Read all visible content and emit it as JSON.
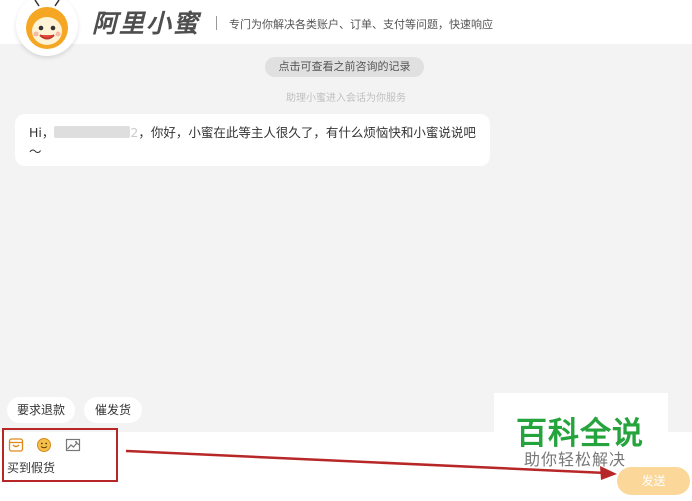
{
  "header": {
    "brand": "阿里小蜜",
    "tagline": "专门为你解决各类账户、订单、支付等问题，快速响应"
  },
  "chat": {
    "history_link": "点击可查看之前咨询的记录",
    "system_note": "助理小蜜进入会话为你服务",
    "greeting": {
      "prefix": "Hi，",
      "masked_suffix": "2",
      "body": "，你好，小蜜在此等主人很久了，有什么烦恼快和小蜜说说吧～"
    }
  },
  "quick_replies": [
    "要求退款",
    "催发货"
  ],
  "toolbar": {
    "icons": [
      "order-icon",
      "emoji-icon",
      "image-icon"
    ]
  },
  "input": {
    "value": "买到假货"
  },
  "send_label": "发送",
  "watermark": {
    "title": "百科全说",
    "subtitle": "助你轻松解决"
  },
  "colors": {
    "brand_orange": "#f5a623",
    "send_button": "#fbd79a",
    "highlight": "#b82727",
    "watermark_green": "#25a33c"
  }
}
